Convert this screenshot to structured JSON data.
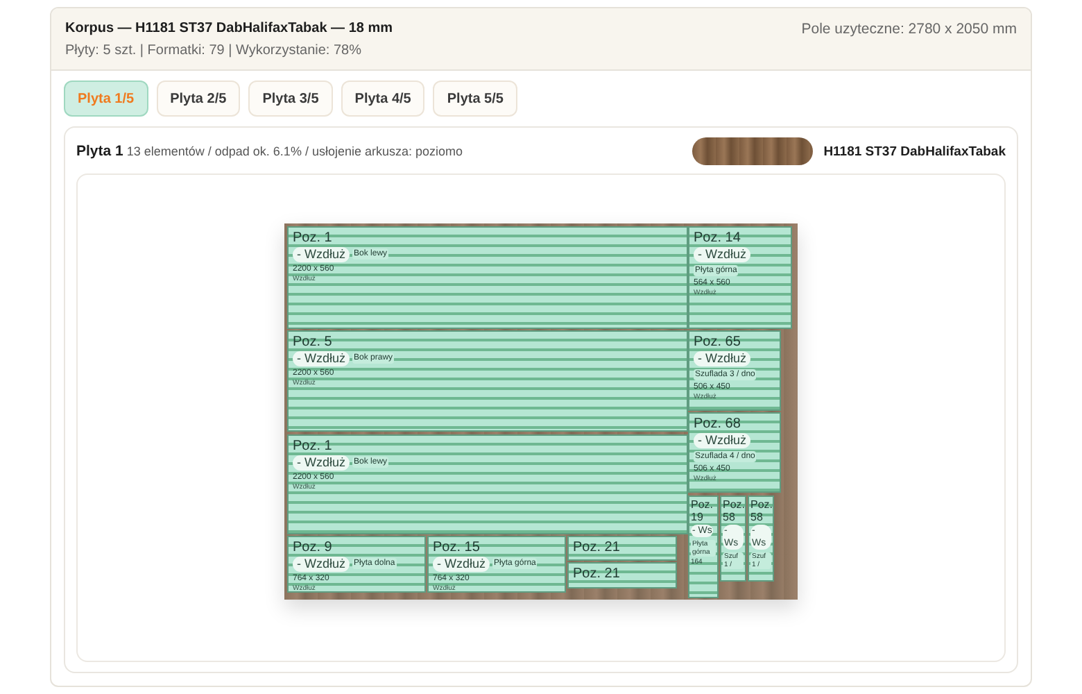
{
  "header": {
    "title": "Korpus — H1181 ST37 DabHalifaxTabak — 18 mm",
    "summary": "Płyty: 5 szt. | Formatki: 79 | Wykorzystanie: 78%",
    "usable_area": "Pole uzyteczne: 2780 x 2050 mm"
  },
  "tabs": [
    {
      "label": "Plyta 1/5",
      "selected": true
    },
    {
      "label": "Plyta 2/5",
      "selected": false
    },
    {
      "label": "Plyta 3/5",
      "selected": false
    },
    {
      "label": "Plyta 4/5",
      "selected": false
    },
    {
      "label": "Plyta 5/5",
      "selected": false
    }
  ],
  "sheet": {
    "title": "Plyta 1",
    "details": "13 elementów / odpad ok. 6.1% / usłojenie arkusza: poziomo",
    "material": "H1181 ST37 DabHalifaxTabak",
    "pieces": [
      {
        "title": "Poz. 1",
        "badge": "- Wzdłuż",
        "label": "Bok lewy",
        "dims": "2200 x 560",
        "note": "Wzdłuż"
      },
      {
        "title": "Poz. 14",
        "badge": "- Wzdłuż",
        "label": "Płyta górna",
        "dims": "564 x 560",
        "note": "Wzdłuż"
      },
      {
        "title": "Poz. 5",
        "badge": "- Wzdłuż",
        "label": "Bok prawy",
        "dims": "2200 x 560",
        "note": "Wzdłuż"
      },
      {
        "title": "Poz. 65",
        "badge": "- Wzdłuż",
        "label": "Szuflada 3 / dno",
        "dims": "506 x 450",
        "note": "Wzdłuż"
      },
      {
        "title": "Poz. 1",
        "badge": "- Wzdłuż",
        "label": "Bok lewy",
        "dims": "2200 x 560",
        "note": "Wzdłuż"
      },
      {
        "title": "Poz. 68",
        "badge": "- Wzdłuż",
        "label": "Szuflada 4 / dno",
        "dims": "506 x 450",
        "note": "Wzdłuż"
      },
      {
        "title": "Poz. 9",
        "badge": "- Wzdłuż",
        "label": "Płyta dolna",
        "dims": "764 x 320",
        "note": "Wzdłuż"
      },
      {
        "title": "Poz. 15",
        "badge": "- Wzdłuż",
        "label": "Płyta górna",
        "dims": "764 x 320",
        "note": "Wzdłuż"
      },
      {
        "title": "Poz. 21"
      },
      {
        "title": "Poz. 21"
      },
      {
        "title": "Poz. 19",
        "badge": "- Ws",
        "label": "Płyta górna",
        "dims": "164"
      },
      {
        "title": "Poz. 58",
        "badge": "- Ws",
        "label": "Szuf 1 /"
      },
      {
        "title": "Poz. 58",
        "badge": "- Ws",
        "label": "Szuf 1 /"
      }
    ]
  }
}
